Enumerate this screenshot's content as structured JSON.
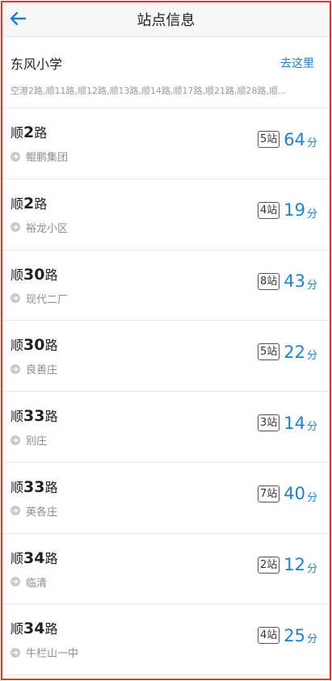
{
  "header": {
    "title": "站点信息",
    "back_icon": "arrow-left-icon",
    "accent": "#1f82c9"
  },
  "stop": {
    "name": "东风小学",
    "action_label": "去这里",
    "routes_summary": "空港2路,顺11路,顺12路,顺13路,顺14路,顺17路,顺21路,顺28路,顺..."
  },
  "arrivals": [
    {
      "prefix": "顺",
      "number": "2",
      "suffix": "路",
      "destination": "鲲鹏集团",
      "stops": "5站",
      "minutes": "64",
      "unit": "分"
    },
    {
      "prefix": "顺",
      "number": "2",
      "suffix": "路",
      "destination": "裕龙小区",
      "stops": "4站",
      "minutes": "19",
      "unit": "分"
    },
    {
      "prefix": "顺",
      "number": "30",
      "suffix": "路",
      "destination": "现代二厂",
      "stops": "8站",
      "minutes": "43",
      "unit": "分"
    },
    {
      "prefix": "顺",
      "number": "30",
      "suffix": "路",
      "destination": "良善庄",
      "stops": "5站",
      "minutes": "22",
      "unit": "分"
    },
    {
      "prefix": "顺",
      "number": "33",
      "suffix": "路",
      "destination": "别庄",
      "stops": "3站",
      "minutes": "14",
      "unit": "分"
    },
    {
      "prefix": "顺",
      "number": "33",
      "suffix": "路",
      "destination": "英各庄",
      "stops": "7站",
      "minutes": "40",
      "unit": "分"
    },
    {
      "prefix": "顺",
      "number": "34",
      "suffix": "路",
      "destination": "临清",
      "stops": "2站",
      "minutes": "12",
      "unit": "分"
    },
    {
      "prefix": "顺",
      "number": "34",
      "suffix": "路",
      "destination": "牛栏山一中",
      "stops": "4站",
      "minutes": "25",
      "unit": "分"
    }
  ]
}
